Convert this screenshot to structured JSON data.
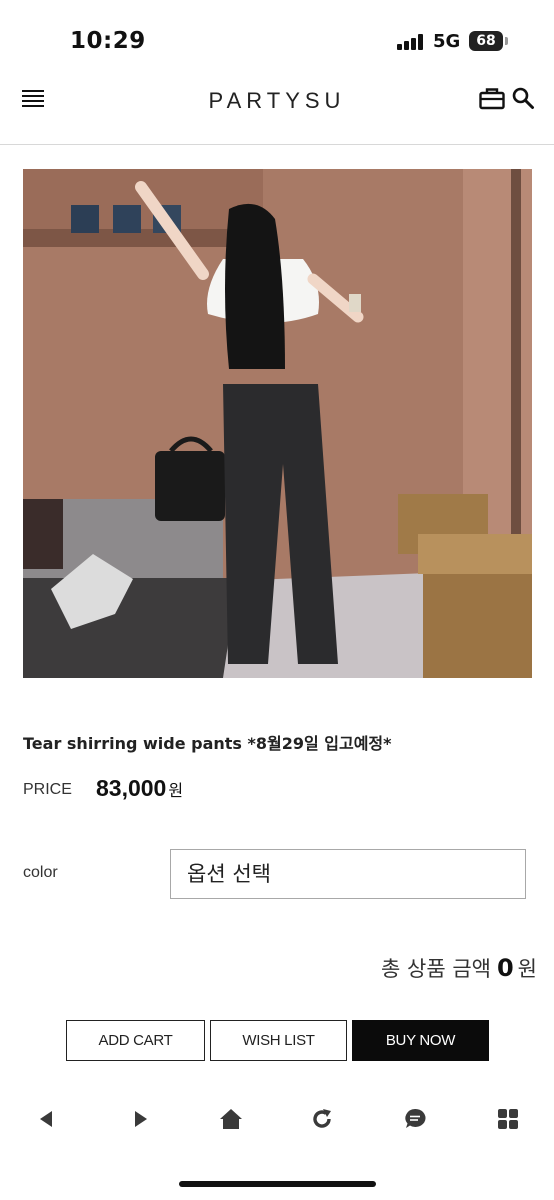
{
  "status_bar": {
    "time": "10:29",
    "network": "5G",
    "battery": "68"
  },
  "header": {
    "logo": "PARTYSU",
    "menu_icon": "menu-icon",
    "bag_icon": "shopping-bag-icon",
    "search_icon": "search-icon"
  },
  "product": {
    "name": "Tear shirring wide pants *8월29일 입고예정*",
    "price_label": "PRICE",
    "price": "83,000",
    "price_unit": "원"
  },
  "option": {
    "label": "color",
    "placeholder": "옵션 선택"
  },
  "total": {
    "label": "총 상품 금액",
    "value": "0",
    "unit": "원"
  },
  "buttons": {
    "add_cart": "ADD CART",
    "wish_list": "WISH LIST",
    "buy_now": "BUY NOW"
  },
  "bottom_nav": [
    "back-icon",
    "forward-icon",
    "home-icon",
    "refresh-icon",
    "chat-icon",
    "grid-icon"
  ],
  "colors": {
    "accent": "#0b0b0b",
    "wall": "#a87a66"
  }
}
